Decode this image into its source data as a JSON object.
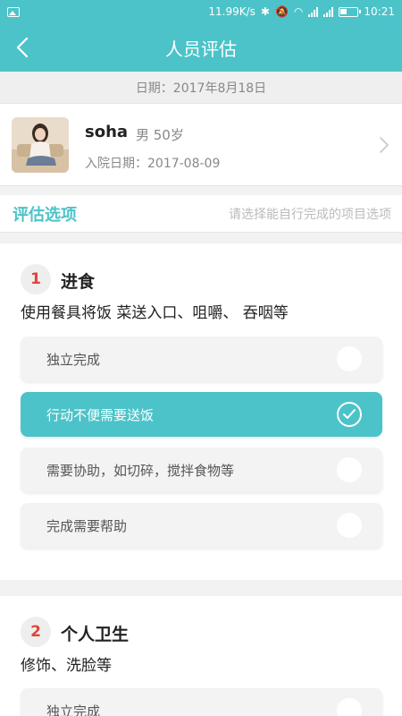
{
  "status_bar": {
    "net_speed": "11.99K/s",
    "time": "10:21"
  },
  "header": {
    "title": "人员评估"
  },
  "date_bar": {
    "text": "日期：2017年8月18日"
  },
  "person": {
    "name": "soha",
    "gender_age": "男 50岁",
    "admit_date": "入院日期：2017-08-09"
  },
  "section": {
    "label": "评估选项",
    "hint": "请选择能自行完成的项目选项"
  },
  "questions": [
    {
      "number": "1",
      "title": "进食",
      "desc": "使用餐具将饭 菜送入口、咀嚼、 吞咽等",
      "options": [
        "独立完成",
        "行动不便需要送饭",
        "需要协助，如切碎，搅拌食物等",
        "完成需要帮助"
      ],
      "selected_index": 1
    },
    {
      "number": "2",
      "title": "个人卫生",
      "desc": "修饰、洗脸等",
      "options": [
        "独立完成"
      ]
    }
  ],
  "colors": {
    "accent": "#4cc3c9",
    "number": "#e0433a"
  }
}
